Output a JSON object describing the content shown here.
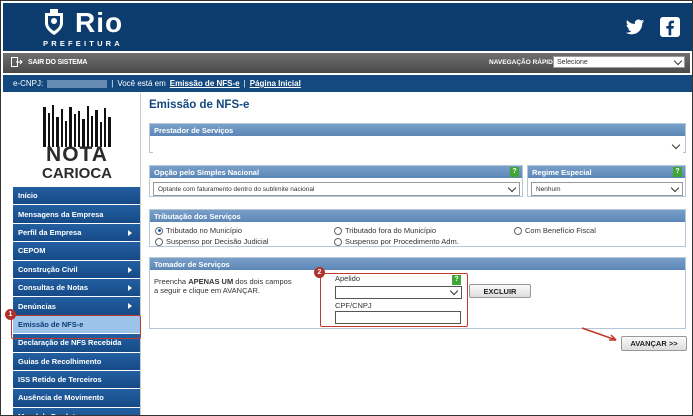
{
  "header": {
    "logo_text": "Rio",
    "logo_sub": "PREFEITURA",
    "social": [
      "twitter-icon",
      "facebook-icon"
    ]
  },
  "topbar": {
    "logout": "SAIR DO SISTEMA",
    "nav_label": "NAVEGAÇÃO RÁPIDA",
    "nav_value": "Selecione"
  },
  "breadcrumb": {
    "cnpj_label": "e-CNPJ:",
    "sep": "|",
    "prefix": "Você está em",
    "current": "Emissão de NFS-e",
    "sep2": "|",
    "home": "Página Inicial"
  },
  "brand": {
    "line1": "NOTA",
    "line2": "CARIOCA"
  },
  "sidebar": {
    "items": [
      {
        "label": "Início",
        "arrow": false
      },
      {
        "label": "Mensagens da Empresa",
        "arrow": false
      },
      {
        "label": "Perfil da Empresa",
        "arrow": true
      },
      {
        "label": "CEPOM",
        "arrow": false
      },
      {
        "label": "Construção Civil",
        "arrow": true
      },
      {
        "label": "Consultas de Notas",
        "arrow": true
      },
      {
        "label": "Denúncias",
        "arrow": true
      },
      {
        "label": "Emissão de NFS-e",
        "arrow": false,
        "active": true
      },
      {
        "label": "Declaração de NFS Recebida",
        "arrow": false
      },
      {
        "label": "Guias de Recolhimento",
        "arrow": false
      },
      {
        "label": "ISS Retido de Terceiros",
        "arrow": false
      },
      {
        "label": "Ausência de Movimento",
        "arrow": false
      },
      {
        "label": "Mural de Produtos",
        "arrow": false
      }
    ]
  },
  "steps": {
    "one": "1",
    "two": "2"
  },
  "main": {
    "title": "Emissão de NFS-e",
    "prestador": {
      "header": "Prestador de Serviços",
      "value": ""
    },
    "simples": {
      "header": "Opção pelo Simples Nacional",
      "help": "?",
      "value": "Optante com faturamento dentro do sublimite nacional"
    },
    "regime": {
      "header": "Regime Especial",
      "help": "?",
      "value": "Nenhum"
    },
    "tributacao": {
      "header": "Tributação dos Serviços",
      "options": [
        "Tributado no Município",
        "Tributado fora do Município",
        "Com Benefício Fiscal",
        "Suspenso por Decisão Judicial",
        "Suspenso por Procedimento Adm."
      ],
      "selected": "Tributado no Município"
    },
    "tomador": {
      "header": "Tomador de Serviços",
      "hint_pre": "Preencha ",
      "hint_bold": "APENAS UM",
      "hint_post": " dos dois campos",
      "hint_line2": "a seguir e clique em AVANÇAR.",
      "apelido_label": "Apelido",
      "apelido_help": "?",
      "apelido_value": "",
      "cpf_label": "CPF/CNPJ",
      "cpf_value": "",
      "excluir": "EXCLUIR"
    },
    "avancar": "AVANÇAR >>"
  },
  "colors": {
    "header": "#0c3b6e",
    "menu": "#1f5a9a",
    "section": "#6a93c0",
    "highlight": "#c0392b",
    "help": "#3fa535"
  }
}
